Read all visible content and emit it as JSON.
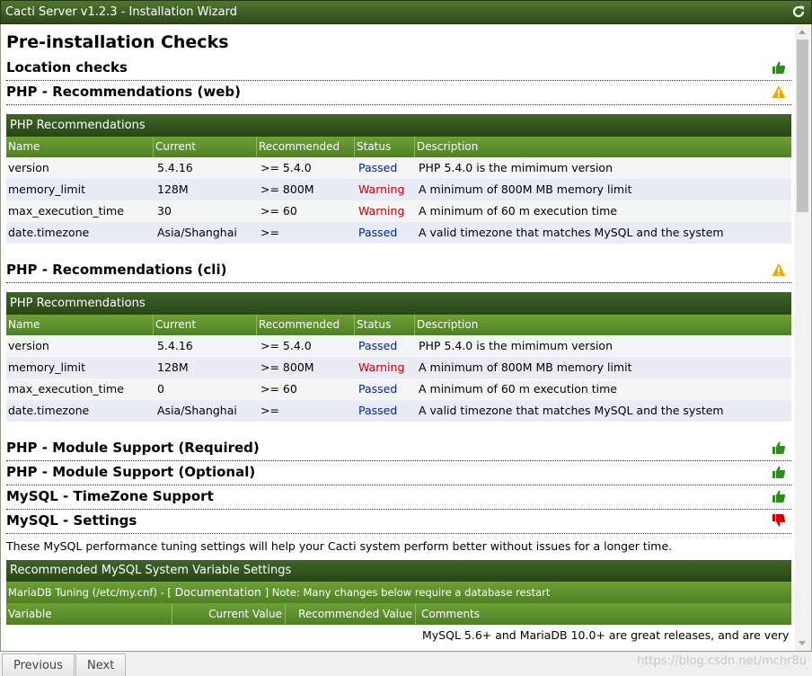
{
  "window": {
    "title": "Cacti Server v1.2.3 - Installation Wizard",
    "refresh_icon": "refresh-icon"
  },
  "page_title": "Pre-installation Checks",
  "sections": {
    "location": {
      "title": "Location checks",
      "status_icon": "thumbs-up-icon"
    },
    "php_web": {
      "title": "PHP - Recommendations (web)",
      "status_icon": "warning-icon"
    },
    "php_cli": {
      "title": "PHP - Recommendations (cli)",
      "status_icon": "warning-icon"
    },
    "module_required": {
      "title": "PHP - Module Support (Required)",
      "status_icon": "thumbs-up-icon"
    },
    "module_optional": {
      "title": "PHP - Module Support (Optional)",
      "status_icon": "thumbs-up-icon"
    },
    "mysql_tz": {
      "title": "MySQL - TimeZone Support",
      "status_icon": "thumbs-up-icon"
    },
    "mysql_settings": {
      "title": "MySQL - Settings",
      "status_icon": "thumbs-down-icon"
    }
  },
  "php_web_table": {
    "heading": "PHP Recommendations",
    "columns": [
      "Name",
      "Current",
      "Recommended",
      "Status",
      "Description"
    ],
    "rows": [
      {
        "name": "version",
        "current": "5.4.16",
        "recommended": ">= 5.4.0",
        "status": "Passed",
        "description": "PHP 5.4.0 is the mimimum version"
      },
      {
        "name": "memory_limit",
        "current": "128M",
        "recommended": ">= 800M",
        "status": "Warning",
        "description": "A minimum of 800M MB memory limit"
      },
      {
        "name": "max_execution_time",
        "current": "30",
        "recommended": ">= 60",
        "status": "Warning",
        "description": "A minimum of 60 m execution time"
      },
      {
        "name": "date.timezone",
        "current": "Asia/Shanghai",
        "recommended": ">=",
        "status": "Passed",
        "description": "A valid timezone that matches MySQL and the system"
      }
    ]
  },
  "php_cli_table": {
    "heading": "PHP Recommendations",
    "columns": [
      "Name",
      "Current",
      "Recommended",
      "Status",
      "Description"
    ],
    "rows": [
      {
        "name": "version",
        "current": "5.4.16",
        "recommended": ">= 5.4.0",
        "status": "Passed",
        "description": "PHP 5.4.0 is the mimimum version"
      },
      {
        "name": "memory_limit",
        "current": "128M",
        "recommended": ">= 800M",
        "status": "Warning",
        "description": "A minimum of 800M MB memory limit"
      },
      {
        "name": "max_execution_time",
        "current": "0",
        "recommended": ">= 60",
        "status": "Passed",
        "description": "A minimum of 60 m execution time"
      },
      {
        "name": "date.timezone",
        "current": "Asia/Shanghai",
        "recommended": ">=",
        "status": "Passed",
        "description": "A valid timezone that matches MySQL and the system"
      }
    ]
  },
  "mysql": {
    "note": "These MySQL performance tuning settings will help your Cacti system perform better without issues for a longer time.",
    "table_heading": "Recommended MySQL System Variable Settings",
    "tuning_prefix": "MariaDB Tuning (/etc/my.cnf) - [ ",
    "doc_link": "Documentation",
    "tuning_suffix": " ] Note: Many changes below require a database restart",
    "columns": [
      "Variable",
      "Current Value",
      "Recommended Value",
      "Comments"
    ],
    "first_comment": "MySQL 5.6+ and MariaDB 10.0+ are great releases, and are very"
  },
  "buttons": {
    "previous": "Previous",
    "next": "Next"
  },
  "watermark": "https://blog.csdn.net/mchr8u",
  "colors": {
    "passed": "#001f9c",
    "warning": "#c40000",
    "header_green": "#3f6428",
    "column_green": "#6da035",
    "thumbs_up": "#2e8b1e",
    "thumbs_down": "#d40000",
    "warning_icon": "#f0a800"
  }
}
